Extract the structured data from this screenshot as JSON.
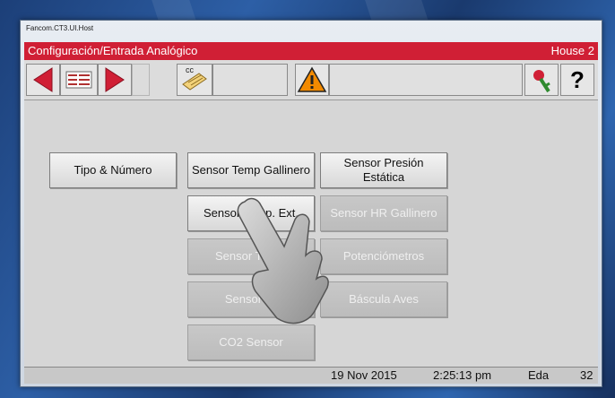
{
  "window": {
    "title": "Fancom.CT3.UI.Host"
  },
  "header": {
    "title": "Configuración/Entrada Analógico",
    "house": "House 2"
  },
  "toolbar": {
    "cc_label": "cc",
    "help_label": "?",
    "colors": {
      "arrow": "#d01f35",
      "warning": "#f28a00"
    }
  },
  "buttons": {
    "tipo_numero": "Tipo & Número",
    "sensor_temp_gallinero": "Sensor Temp Gallinero",
    "sensor_presion_estatica": "Sensor Presión Estática",
    "sensor_temp_ext": "Sensor Temp. Ext.",
    "sensor_hr_gallinero": "Sensor HR Gallinero",
    "sensor_temp_3": "Sensor Temp.",
    "potenciometros": "Potenciómetros",
    "sensor_te": "Sensor Te",
    "bascula_aves": "Báscula Aves",
    "co2_sensor": "CO2 Sensor"
  },
  "status": {
    "date": "19 Nov 2015",
    "time": "2:25:13 pm",
    "user": "Eda",
    "number": "32"
  }
}
